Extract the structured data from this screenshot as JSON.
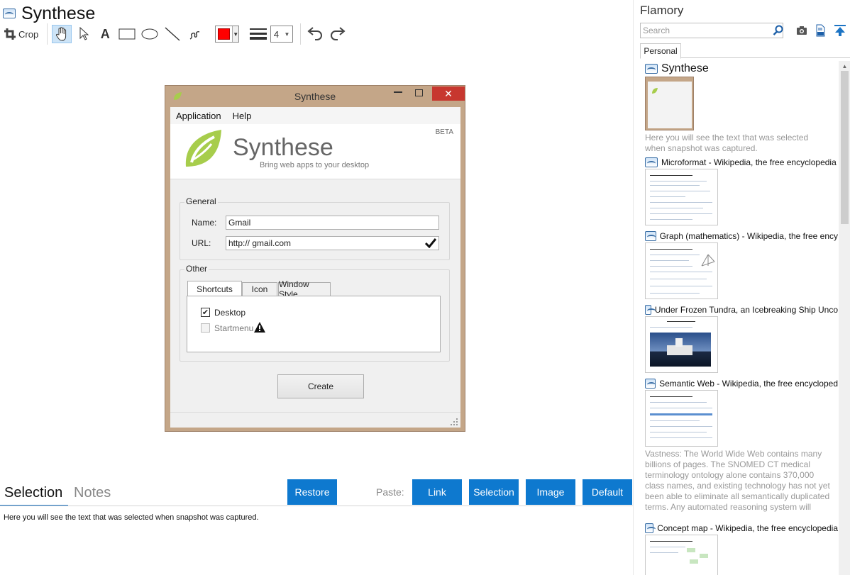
{
  "document": {
    "title": "Synthese"
  },
  "toolbar": {
    "crop_label": "Crop",
    "text_tool_glyph": "A",
    "color": "#ff0000",
    "line_width": "4"
  },
  "screenshot": {
    "window_title": "Synthese",
    "menu": [
      "Application",
      "Help"
    ],
    "beta_label": "BETA",
    "app_name": "Synthese",
    "tagline": "Bring web apps to your desktop",
    "general_group": "General",
    "name_label": "Name:",
    "name_value": "Gmail",
    "url_label": "URL:",
    "url_value": "http:// gmail.com",
    "other_group": "Other",
    "tabs": [
      "Shortcuts",
      "Icon",
      "Window Style"
    ],
    "desktop_label": "Desktop",
    "desktop_checked": true,
    "startmenu_label": "Startmenu",
    "startmenu_checked": false,
    "create_label": "Create"
  },
  "bottom": {
    "tab_selection": "Selection",
    "tab_notes": "Notes",
    "restore_label": "Restore",
    "paste_label": "Paste:",
    "paste_buttons": [
      "Link",
      "Selection",
      "Image",
      "Default"
    ],
    "selection_text": "Here you will see the text that was selected when snapshot was captured."
  },
  "sidebar": {
    "app_title": "Flamory",
    "search_placeholder": "Search",
    "tab_personal": "Personal",
    "items": [
      {
        "title": "Synthese",
        "description": "Here you will see the text that was selected when snapshot was captured."
      },
      {
        "title": "Microformat - Wikipedia, the free encyclopedia"
      },
      {
        "title": "Graph (mathematics) - Wikipedia, the free ency"
      },
      {
        "title": "Under Frozen Tundra, an Icebreaking Ship Unco"
      },
      {
        "title": "Semantic Web - Wikipedia, the free encycloped",
        "description": "Vastness: The World Wide Web contains many billions of pages. The SNOMED CT medical terminology ontology alone contains 370,000 class names, and existing technology has not yet been able to eliminate all semantically duplicated terms. Any automated reasoning system will have to deal with truly huge inputs."
      },
      {
        "title": "Concept map - Wikipedia, the free encyclopedia"
      }
    ]
  },
  "colors": {
    "accent": "#0e79cf",
    "close": "#c7372f",
    "window_frame": "#c4a688",
    "logo_leaf": "#a7cd4c"
  }
}
